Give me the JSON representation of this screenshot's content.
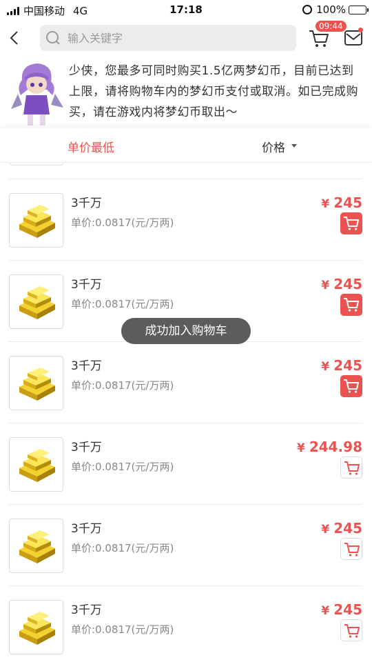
{
  "status_bar": {
    "carrier": "中国移动",
    "network": "4G",
    "time": "17:18",
    "battery_percent": "100%"
  },
  "header": {
    "search_placeholder": "输入关键字",
    "timer_badge": "09:44"
  },
  "notice": {
    "text": "少侠，您最多可同时购买1.5亿两梦幻币，目前已达到上限，请将购物车内的梦幻币支付或取消。如已完成购买，请在游戏内将梦幻币取出～"
  },
  "sort": {
    "price_low": "单价最低",
    "price": "价格"
  },
  "toast": "成功加入购物车",
  "currency_symbol": "¥",
  "items": [
    {
      "title": "3千万",
      "unit_price": "单价:0.0817(元/万两)",
      "price": "245",
      "in_cart": true
    },
    {
      "title": "3千万",
      "unit_price": "单价:0.0817(元/万两)",
      "price": "245",
      "in_cart": true
    },
    {
      "title": "3千万",
      "unit_price": "单价:0.0817(元/万两)",
      "price": "245",
      "in_cart": true
    },
    {
      "title": "3千万",
      "unit_price": "单价:0.0817(元/万两)",
      "price": "244.98",
      "in_cart": false
    },
    {
      "title": "3千万",
      "unit_price": "单价:0.0817(元/万两)",
      "price": "245",
      "in_cart": false
    },
    {
      "title": "3千万",
      "unit_price": "单价:0.0817(元/万两)",
      "price": "245",
      "in_cart": false
    }
  ],
  "colors": {
    "accent": "#e95451",
    "gold": "#e8c21a",
    "search_bg": "#ececec"
  }
}
